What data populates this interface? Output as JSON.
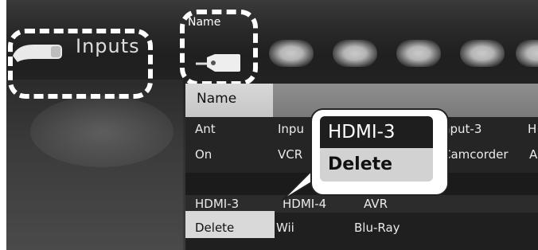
{
  "top_bar": {
    "items": [
      "Name",
      "",
      "",
      "",
      ""
    ]
  },
  "left": {
    "inputs_label": "Inputs"
  },
  "name_panel": {
    "header": "Name",
    "rows": [
      [
        "Ant",
        "Inpu",
        "",
        "nput-3",
        "H"
      ],
      [
        "On",
        "VCR",
        "",
        "Camcorder",
        "A"
      ],
      [
        "HDMI-3",
        "HDMI-4",
        "AVR"
      ],
      [
        "Delete",
        "Wii",
        "Blu-Ray"
      ]
    ]
  },
  "popup": {
    "title": "HDMI-3",
    "action": "Delete"
  },
  "icons": {
    "plug": "plug-icon",
    "tag": "tag-icon"
  }
}
